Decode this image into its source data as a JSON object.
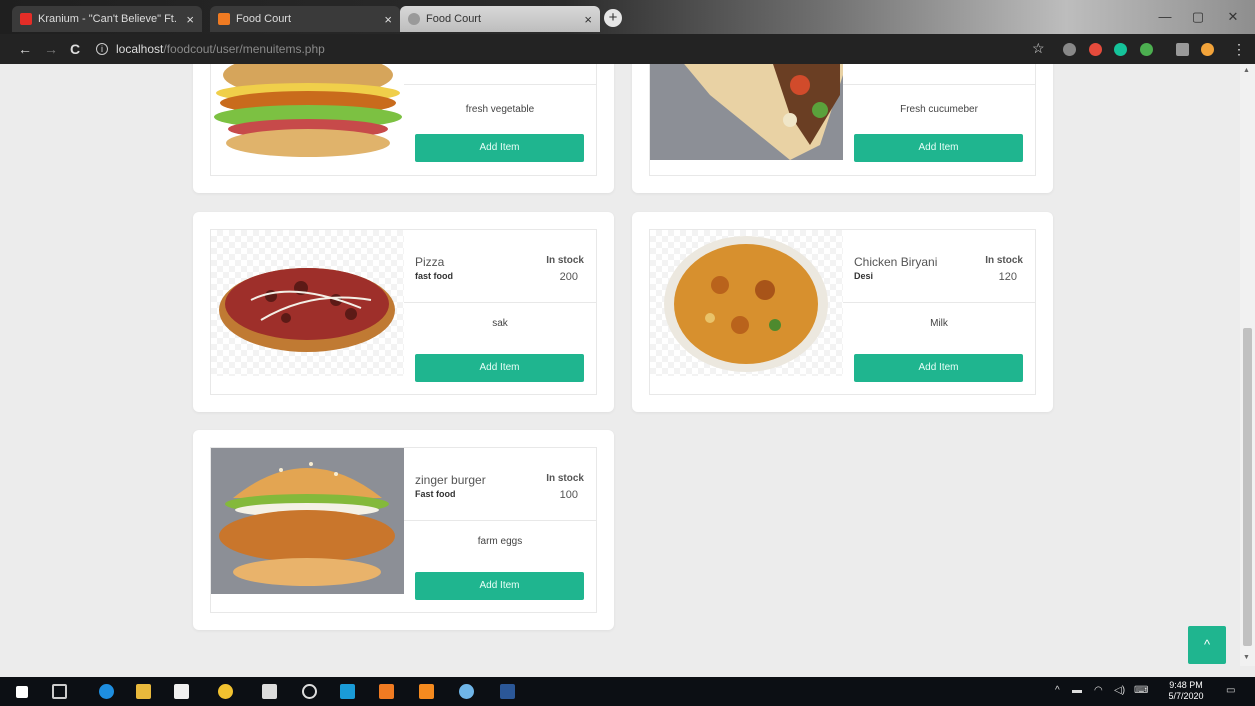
{
  "browser": {
    "tabs": [
      {
        "title": "Kranium - \"Can't Believe\" Ft.",
        "close": "×",
        "favicon": "youtube-icon"
      },
      {
        "title": "Food Court",
        "close": "×",
        "favicon": "xampp-icon"
      },
      {
        "title": "Food Court",
        "close": "×",
        "favicon": "globe-icon"
      }
    ],
    "new_tab": "+",
    "window_controls": {
      "minimize": "—",
      "maximize": "▢",
      "close": "✕"
    },
    "nav": {
      "back": "←",
      "forward": "→",
      "reload": "C"
    },
    "url_host": "localhost",
    "url_path": "/foodcout/user/menuitems.php",
    "star": "☆"
  },
  "menu_items": [
    {
      "name": "",
      "category": "",
      "stock_label": "",
      "stock": "",
      "description": "fresh vegetable",
      "button": "Add Item",
      "image": "chicken-burger"
    },
    {
      "name": "",
      "category": "",
      "stock_label": "",
      "stock": "",
      "description": "Fresh cucumeber",
      "button": "Add Item",
      "image": "shawarma-wrap"
    },
    {
      "name": "Pizza",
      "category": "fast food",
      "stock_label": "In stock",
      "stock": "200",
      "description": "sak",
      "button": "Add Item",
      "image": "pizza"
    },
    {
      "name": "Chicken Biryani",
      "category": "Desi",
      "stock_label": "In stock",
      "stock": "120",
      "description": "Milk",
      "button": "Add Item",
      "image": "biryani"
    },
    {
      "name": "zinger burger",
      "category": "Fast food",
      "stock_label": "In stock",
      "stock": "100",
      "description": "farm eggs",
      "button": "Add Item",
      "image": "zinger-burger"
    }
  ],
  "scroll_top_button": "^",
  "taskbar": {
    "time": "9:48 PM",
    "date": "5/7/2020",
    "tray_chevron": "^"
  },
  "colors": {
    "accent": "#1fb58f",
    "page_bg": "#ececec"
  }
}
